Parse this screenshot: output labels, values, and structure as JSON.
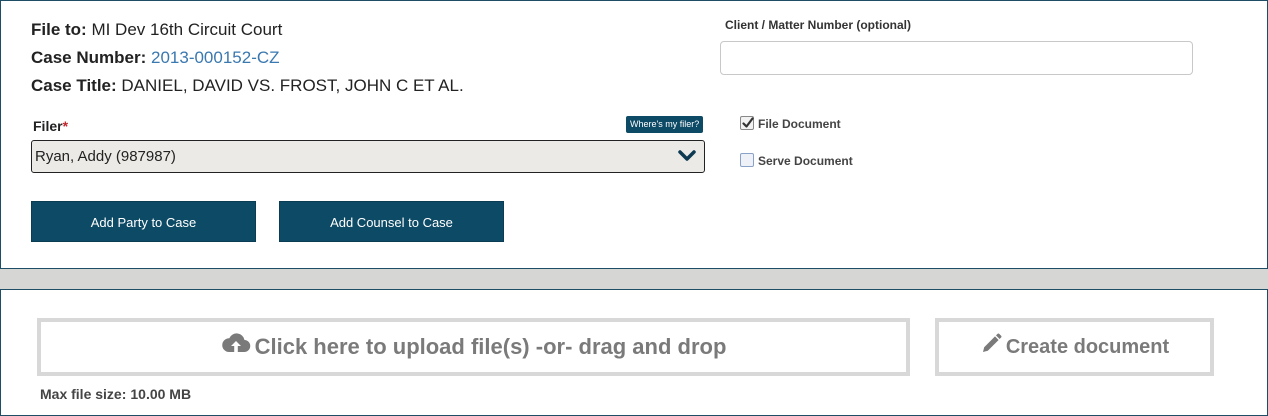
{
  "case_info": {
    "file_to_label": "File to:",
    "file_to_value": "MI Dev 16th Circuit Court",
    "case_number_label": "Case Number:",
    "case_number_value": "2013-000152-CZ",
    "case_title_label": "Case Title:",
    "case_title_value": "DANIEL, DAVID VS. FROST, JOHN C ET AL."
  },
  "filer": {
    "label": "Filer",
    "required_mark": "*",
    "help_button": "Where's my filer?",
    "selected": "Ryan, Addy (987987)",
    "chevron_icon": "chevron-down-icon"
  },
  "actions": {
    "add_party": "Add Party to Case",
    "add_counsel": "Add Counsel to Case"
  },
  "client_matter": {
    "label": "Client / Matter Number (optional)",
    "value": "",
    "placeholder": ""
  },
  "options": {
    "file_document": {
      "label": "File Document",
      "checked": true
    },
    "serve_document": {
      "label": "Serve Document",
      "checked": false
    }
  },
  "upload": {
    "label": "Click here to upload file(s) -or- drag and drop",
    "icon": "cloud-upload-icon",
    "max_size_label": "Max file size:",
    "max_size_value": "10.00 MB"
  },
  "create": {
    "label": "Create document",
    "icon": "pencil-icon"
  },
  "colors": {
    "primary": "#0d4a66",
    "link": "#3a78b0",
    "required": "#c0262c",
    "muted_button_text": "#7a7a7a",
    "band": "#d6d6d4"
  }
}
